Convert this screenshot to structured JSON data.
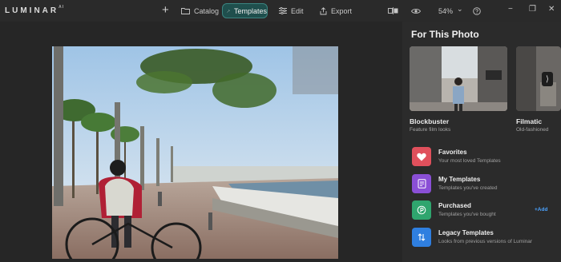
{
  "app": {
    "logo": "LUMINAR",
    "logo_sup": "AI"
  },
  "topbar": {
    "add_symbol": "+",
    "catalog_label": "Catalog",
    "templates_label": "Templates",
    "edit_label": "Edit",
    "export_label": "Export",
    "zoom": "54%",
    "zoom_chevron": "⌄"
  },
  "window": {
    "minimize": "−",
    "maximize": "❐",
    "close": "✕"
  },
  "panel": {
    "title": "For This Photo",
    "cards": [
      {
        "name": "Blockbuster",
        "subtitle": "Feature film looks"
      },
      {
        "name": "Filmatic",
        "subtitle": "Old-fashioned"
      }
    ],
    "next_arrow": "⟩",
    "categories": [
      {
        "name": "Favorites",
        "subtitle": "Your most loved Templates",
        "color": "#e0505c"
      },
      {
        "name": "My Templates",
        "subtitle": "Templates you've created",
        "color": "#8a4fd6"
      },
      {
        "name": "Purchased",
        "subtitle": "Templates you've bought",
        "color": "#2fa56e"
      },
      {
        "name": "Legacy Templates",
        "subtitle": "Looks from previous versions of Luminar",
        "color": "#2f7fe0"
      }
    ],
    "add_label": "+Add"
  },
  "colors": {
    "accent": "#1f4f4d",
    "accent_border": "#3b8480",
    "link": "#4ba3ff"
  }
}
